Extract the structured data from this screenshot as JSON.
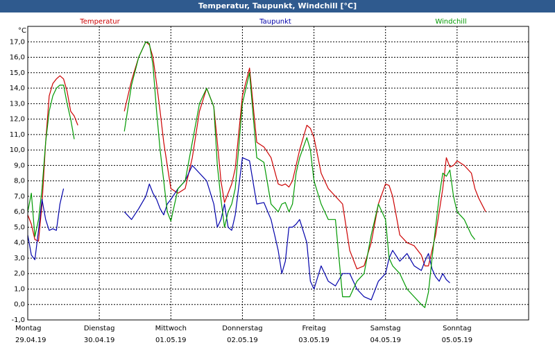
{
  "window": {
    "title": "Temperatur, Taupunkt, Windchill [°C]"
  },
  "colors": {
    "temperatur": "#cc0000",
    "taupunkt": "#0000aa",
    "windchill": "#009900",
    "grid": "#000000",
    "titlebar": "#2f5a8e"
  },
  "chart_data": {
    "type": "line",
    "title": "Temperatur, Taupunkt, Windchill [°C]",
    "ylabel": "°C",
    "ylim": [
      -1.0,
      18.0
    ],
    "yticks": [
      "-1,0",
      "0,0",
      "1,0",
      "2,0",
      "3,0",
      "4,0",
      "5,0",
      "6,0",
      "7,0",
      "8,0",
      "9,0",
      "10,0",
      "11,0",
      "12,0",
      "13,0",
      "14,0",
      "15,0",
      "16,0",
      "17,0"
    ],
    "xlim": [
      0,
      7
    ],
    "x_unit": "days",
    "x_categories": [
      {
        "day": "Montag",
        "date": "29.04.19"
      },
      {
        "day": "Dienstag",
        "date": "30.04.19"
      },
      {
        "day": "Mittwoch",
        "date": "01.05.19"
      },
      {
        "day": "Donnerstag",
        "date": "02.05.19"
      },
      {
        "day": "Freitag",
        "date": "03.05.19"
      },
      {
        "day": "Samstag",
        "date": "04.05.19"
      },
      {
        "day": "Sonntag",
        "date": "05.05.19"
      }
    ],
    "grid": true,
    "legend_position": "top",
    "series": [
      {
        "name": "Temperatur",
        "x": [
          0.0,
          0.05,
          0.1,
          0.15,
          0.2,
          0.25,
          0.3,
          0.35,
          0.4,
          0.45,
          0.5,
          0.55,
          0.6,
          0.65,
          0.7,
          0.75,
          0.8,
          0.85,
          0.9,
          0.95,
          1.35,
          1.45,
          1.55,
          1.65,
          1.7,
          1.75,
          1.8,
          1.85,
          1.9,
          1.95,
          2.0,
          2.1,
          2.2,
          2.3,
          2.4,
          2.5,
          2.6,
          2.65,
          2.7,
          2.75,
          2.8,
          2.85,
          2.9,
          3.0,
          3.1,
          3.2,
          3.3,
          3.4,
          3.5,
          3.55,
          3.6,
          3.65,
          3.7,
          3.75,
          3.8,
          3.9,
          3.95,
          4.0,
          4.1,
          4.2,
          4.3,
          4.4,
          4.5,
          4.6,
          4.7,
          4.8,
          4.9,
          5.0,
          5.05,
          5.1,
          5.2,
          5.3,
          5.4,
          5.5,
          5.55,
          5.6,
          5.65,
          5.7,
          5.75,
          5.8,
          5.85,
          5.9,
          5.95,
          6.0,
          6.1,
          6.2,
          6.25,
          6.3,
          6.4,
          6.5,
          6.6,
          6.65,
          6.7,
          6.75,
          6.8,
          6.85,
          6.9,
          6.95,
          7.0
        ],
        "y": [
          5.8,
          5.2,
          4.2,
          4.1,
          6.5,
          10.5,
          13.5,
          14.3,
          14.6,
          14.8,
          14.6,
          13.8,
          12.5,
          12.2,
          11.6,
          null,
          null,
          null,
          null,
          null,
          12.5,
          14.5,
          16.0,
          17.0,
          16.8,
          16.0,
          14.3,
          12.5,
          10.5,
          9.0,
          7.5,
          7.2,
          7.5,
          9.5,
          12.5,
          14.0,
          12.8,
          10.5,
          8.0,
          6.6,
          7.2,
          7.8,
          8.8,
          13.5,
          15.3,
          10.5,
          10.2,
          9.5,
          7.8,
          7.7,
          7.8,
          7.6,
          8.0,
          9.0,
          10.0,
          11.6,
          11.4,
          10.8,
          8.5,
          7.5,
          7.0,
          6.5,
          3.5,
          2.3,
          2.5,
          4.0,
          6.5,
          7.8,
          7.7,
          7.0,
          4.5,
          4.0,
          3.8,
          3.2,
          2.5,
          2.5,
          3.5,
          4.5,
          6.0,
          7.5,
          9.5,
          8.9,
          9.0,
          9.3,
          9.0,
          8.5,
          7.5,
          6.9,
          6.0,
          null,
          null,
          null,
          null,
          null,
          null,
          null,
          null,
          null,
          null
        ]
      },
      {
        "name": "Taupunkt",
        "x": [
          0.0,
          0.05,
          0.1,
          0.15,
          0.2,
          0.25,
          0.3,
          0.35,
          0.4,
          0.45,
          0.5,
          0.55,
          0.6,
          0.65,
          0.7,
          0.75,
          0.8,
          0.85,
          0.9,
          0.95,
          1.35,
          1.45,
          1.55,
          1.65,
          1.7,
          1.75,
          1.8,
          1.85,
          1.9,
          1.95,
          2.0,
          2.1,
          2.2,
          2.3,
          2.4,
          2.5,
          2.6,
          2.65,
          2.7,
          2.75,
          2.8,
          2.85,
          2.9,
          3.0,
          3.1,
          3.2,
          3.3,
          3.4,
          3.5,
          3.55,
          3.6,
          3.65,
          3.7,
          3.75,
          3.8,
          3.9,
          3.95,
          4.0,
          4.1,
          4.2,
          4.3,
          4.4,
          4.5,
          4.6,
          4.7,
          4.8,
          4.9,
          5.0,
          5.05,
          5.1,
          5.2,
          5.3,
          5.4,
          5.5,
          5.55,
          5.6,
          5.65,
          5.7,
          5.75,
          5.8,
          5.85,
          5.9,
          5.95,
          6.0,
          6.1,
          6.2,
          6.25,
          6.3,
          6.4,
          6.5,
          6.6,
          6.65,
          6.7,
          6.75,
          6.8,
          6.85,
          6.9,
          6.95,
          7.0
        ],
        "y": [
          4.5,
          3.2,
          2.9,
          4.8,
          6.8,
          5.5,
          4.8,
          4.9,
          4.8,
          6.5,
          7.5,
          null,
          null,
          null,
          null,
          null,
          null,
          null,
          null,
          null,
          6.0,
          5.5,
          6.2,
          7.0,
          7.8,
          7.2,
          6.8,
          6.2,
          5.8,
          6.5,
          6.8,
          7.5,
          8.0,
          9.0,
          8.5,
          8.0,
          6.5,
          5.0,
          5.5,
          6.5,
          5.0,
          4.8,
          5.8,
          9.5,
          9.3,
          6.5,
          6.6,
          5.5,
          3.5,
          2.0,
          2.8,
          5.0,
          5.0,
          5.2,
          5.5,
          4.0,
          1.5,
          1.0,
          2.5,
          1.5,
          1.2,
          2.0,
          2.0,
          1.0,
          0.5,
          0.3,
          1.5,
          2.0,
          3.0,
          3.5,
          2.8,
          3.3,
          2.5,
          2.2,
          2.8,
          3.3,
          2.3,
          1.8,
          1.5,
          2.0,
          1.6,
          1.4,
          null,
          null,
          null,
          null,
          null,
          null,
          null,
          null,
          null,
          null,
          null,
          null,
          null,
          null,
          null,
          null,
          null
        ]
      },
      {
        "name": "Windchill",
        "x": [
          0.0,
          0.05,
          0.1,
          0.15,
          0.2,
          0.25,
          0.3,
          0.35,
          0.4,
          0.45,
          0.5,
          0.55,
          0.6,
          0.65,
          0.7,
          0.75,
          0.8,
          0.85,
          0.9,
          0.95,
          1.35,
          1.45,
          1.55,
          1.65,
          1.7,
          1.75,
          1.8,
          1.85,
          1.9,
          1.95,
          2.0,
          2.1,
          2.2,
          2.3,
          2.4,
          2.5,
          2.6,
          2.65,
          2.7,
          2.75,
          2.8,
          2.85,
          2.9,
          3.0,
          3.1,
          3.2,
          3.3,
          3.4,
          3.5,
          3.55,
          3.6,
          3.65,
          3.7,
          3.75,
          3.8,
          3.9,
          3.95,
          4.0,
          4.1,
          4.2,
          4.3,
          4.4,
          4.5,
          4.6,
          4.7,
          4.8,
          4.9,
          5.0,
          5.05,
          5.1,
          5.2,
          5.3,
          5.4,
          5.5,
          5.55,
          5.6,
          5.65,
          5.7,
          5.75,
          5.8,
          5.85,
          5.9,
          5.95,
          6.0,
          6.1,
          6.2,
          6.25,
          6.3,
          6.4,
          6.5,
          6.6,
          6.65,
          6.7,
          6.75,
          6.8,
          6.85,
          6.9,
          6.95,
          7.0
        ],
        "y": [
          6.0,
          7.2,
          4.4,
          5.5,
          7.5,
          10.5,
          12.5,
          13.5,
          14.0,
          14.2,
          14.2,
          13.0,
          12.0,
          10.7,
          null,
          null,
          null,
          null,
          null,
          null,
          11.2,
          14.2,
          16.0,
          17.0,
          16.9,
          15.5,
          12.5,
          10.0,
          8.0,
          6.0,
          5.4,
          7.5,
          8.0,
          10.5,
          13.0,
          14.0,
          12.8,
          9.0,
          6.8,
          5.0,
          6.0,
          6.5,
          7.5,
          13.0,
          15.0,
          9.5,
          9.2,
          6.5,
          6.0,
          6.5,
          6.6,
          6.0,
          6.5,
          8.5,
          9.5,
          10.8,
          10.0,
          8.0,
          6.5,
          5.5,
          5.5,
          0.5,
          0.5,
          1.5,
          2.0,
          4.5,
          6.5,
          5.5,
          3.0,
          2.5,
          2.0,
          1.0,
          0.5,
          0.0,
          -0.2,
          0.8,
          3.0,
          5.0,
          7.0,
          8.5,
          8.3,
          8.7,
          7.0,
          6.0,
          5.5,
          4.5,
          4.2,
          null,
          null,
          null,
          null,
          null,
          null,
          null,
          null,
          null,
          null,
          null,
          null
        ]
      }
    ]
  }
}
